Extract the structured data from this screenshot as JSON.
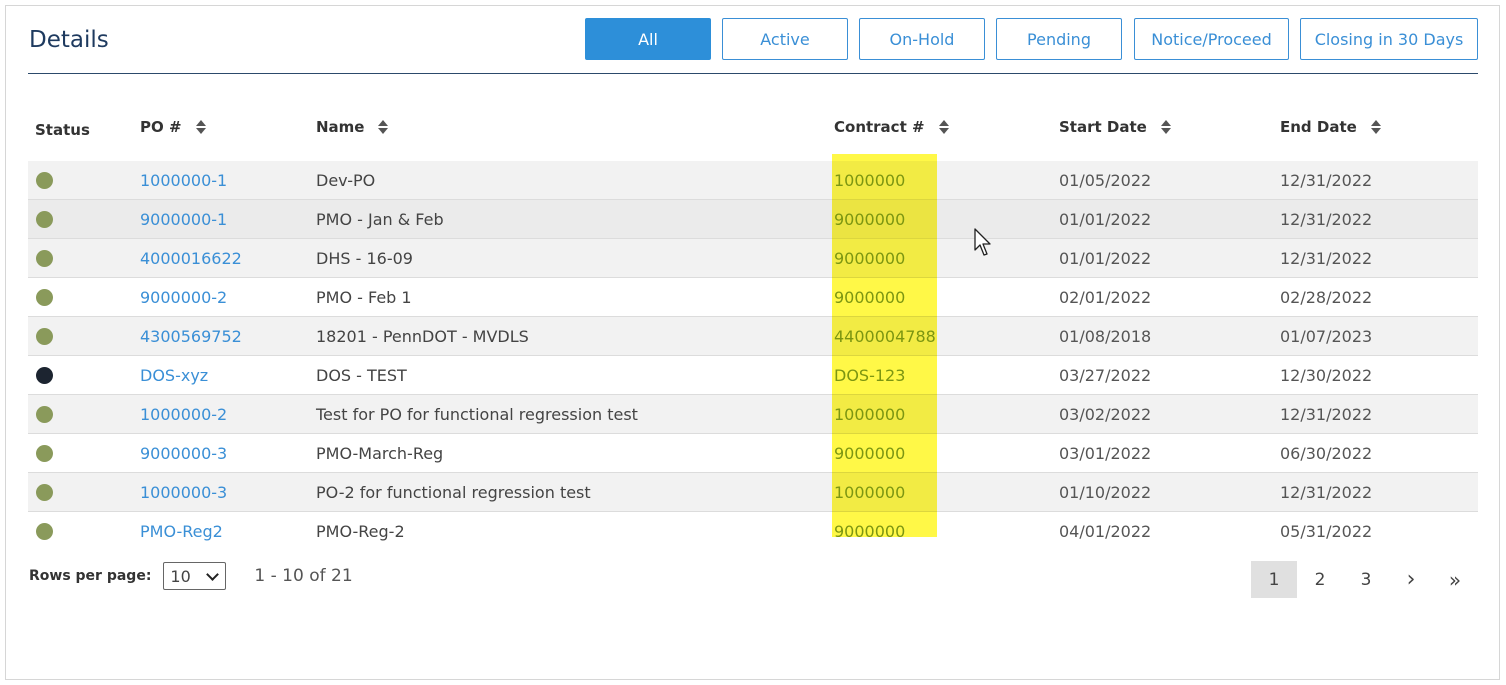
{
  "header": {
    "title": "Details"
  },
  "filters": [
    "All",
    "Active",
    "On-Hold",
    "Pending",
    "Notice/Proceed",
    "Closing in 30 Days"
  ],
  "filters_active": "All",
  "columns": {
    "status": "Status",
    "po": "PO #",
    "name": "Name",
    "contract": "Contract #",
    "start": "Start Date",
    "end": "End Date"
  },
  "rows": [
    {
      "status_color": "#8a9a5b",
      "po": "1000000-1",
      "name": "Dev-PO",
      "contract": "1000000",
      "start": "01/05/2022",
      "end": "12/31/2022"
    },
    {
      "status_color": "#8a9a5b",
      "po": "9000000-1",
      "name": "PMO - Jan & Feb",
      "contract": "9000000",
      "start": "01/01/2022",
      "end": "12/31/2022"
    },
    {
      "status_color": "#8a9a5b",
      "po": "4000016622",
      "name": "DHS - 16-09",
      "contract": "9000000",
      "start": "01/01/2022",
      "end": "12/31/2022"
    },
    {
      "status_color": "#8a9a5b",
      "po": "9000000-2",
      "name": "PMO - Feb 1",
      "contract": "9000000",
      "start": "02/01/2022",
      "end": "02/28/2022"
    },
    {
      "status_color": "#8a9a5b",
      "po": "4300569752",
      "name": "18201 - PennDOT - MVDLS",
      "contract": "4400004788",
      "start": "01/08/2018",
      "end": "01/07/2023"
    },
    {
      "status_color": "#1c2430",
      "po": "DOS-xyz",
      "name": "DOS - TEST",
      "contract": "DOS-123",
      "start": "03/27/2022",
      "end": "12/30/2022"
    },
    {
      "status_color": "#8a9a5b",
      "po": "1000000-2",
      "name": "Test for PO for functional regression test",
      "contract": "1000000",
      "start": "03/02/2022",
      "end": "12/31/2022"
    },
    {
      "status_color": "#8a9a5b",
      "po": "9000000-3",
      "name": "PMO-March-Reg",
      "contract": "9000000",
      "start": "03/01/2022",
      "end": "06/30/2022"
    },
    {
      "status_color": "#8a9a5b",
      "po": "1000000-3",
      "name": "PO-2 for functional regression test",
      "contract": "1000000",
      "start": "01/10/2022",
      "end": "12/31/2022"
    },
    {
      "status_color": "#8a9a5b",
      "po": "PMO-Reg2",
      "name": "PMO-Reg-2",
      "contract": "9000000",
      "start": "04/01/2022",
      "end": "05/31/2022"
    }
  ],
  "footer": {
    "rows_per_page_label": "Rows per page:",
    "rows_per_page_value": "10",
    "range": "1 - 10 of 21"
  },
  "pagination": {
    "pages": [
      "1",
      "2",
      "3"
    ],
    "current": "1",
    "next_icon": "›",
    "last_icon": "»"
  },
  "colors": {
    "accent": "#2d8fd9",
    "link": "#3a8fd6",
    "status_active": "#8a9a5b",
    "status_other": "#1c2430",
    "highlight": "#fff500"
  }
}
